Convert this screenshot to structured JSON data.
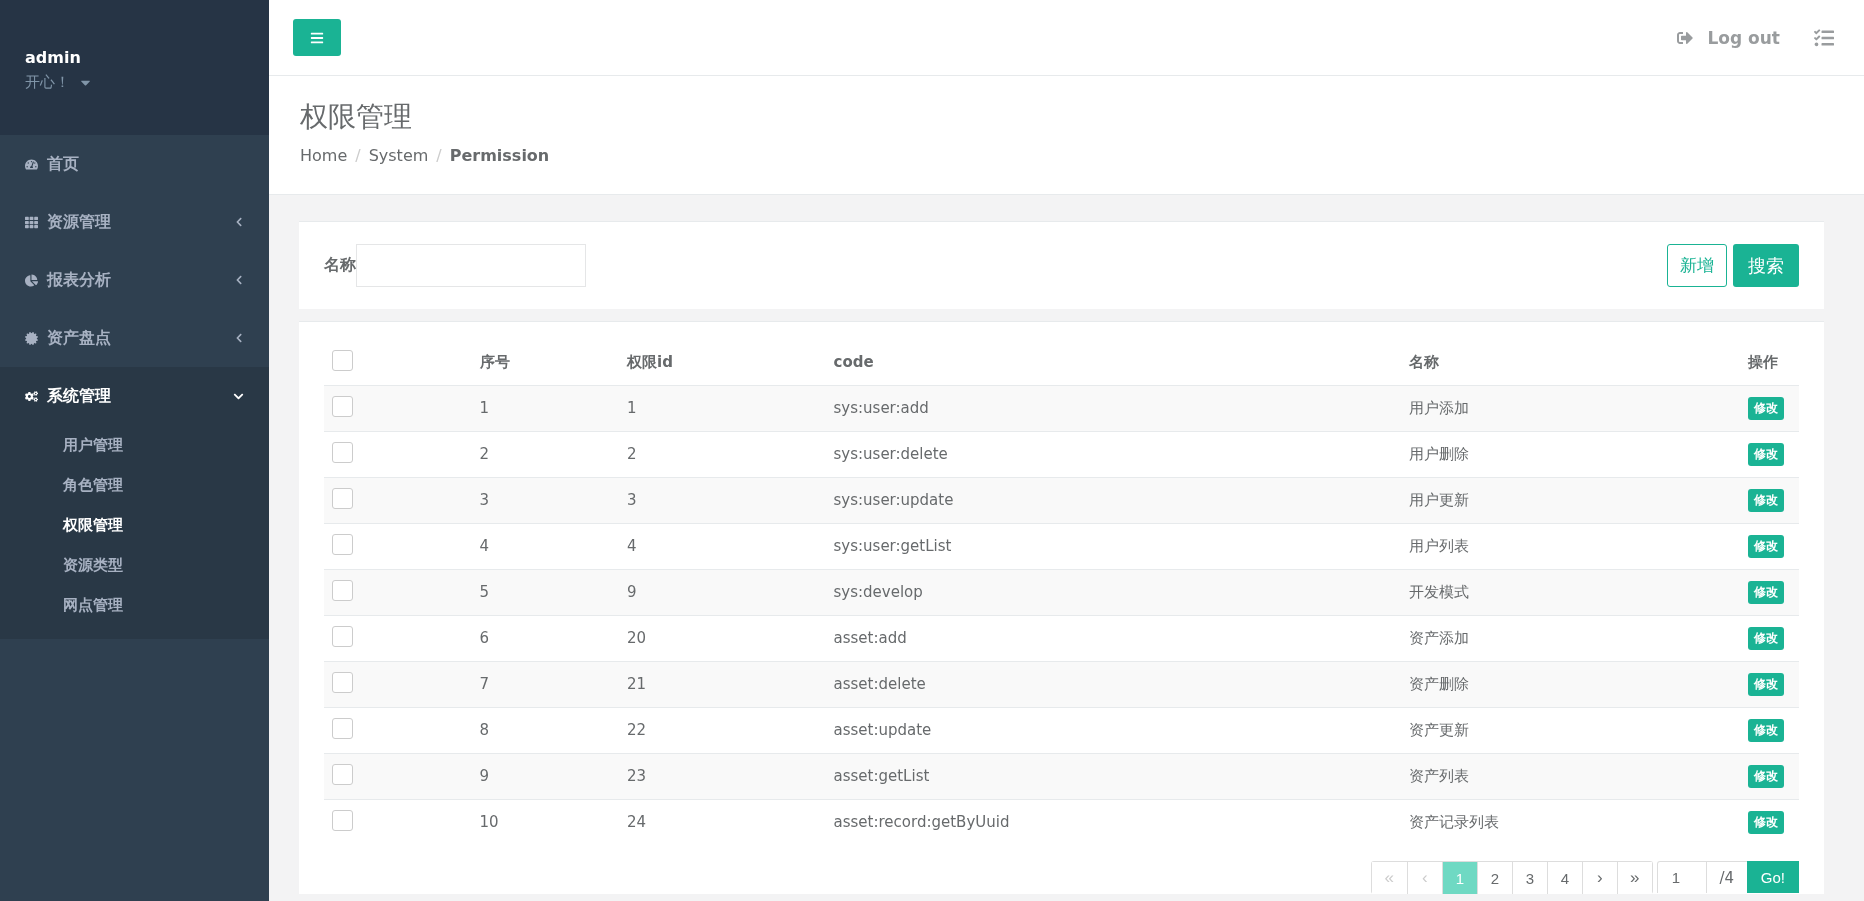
{
  "profile": {
    "name": "admin",
    "status": "开心！"
  },
  "sidebar": {
    "items": [
      {
        "label": "首页"
      },
      {
        "label": "资源管理",
        "expanded": false
      },
      {
        "label": "报表分析",
        "expanded": false
      },
      {
        "label": "资产盘点",
        "expanded": false
      },
      {
        "label": "系统管理",
        "expanded": true,
        "children": [
          {
            "label": "用户管理",
            "selected": false
          },
          {
            "label": "角色管理",
            "selected": false
          },
          {
            "label": "权限管理",
            "selected": true
          },
          {
            "label": "资源类型",
            "selected": false
          },
          {
            "label": "网点管理",
            "selected": false
          }
        ]
      }
    ]
  },
  "topbar": {
    "logout": "Log out"
  },
  "page_header": {
    "title": "权限管理",
    "separator": "/",
    "breadcrumb": [
      {
        "label": "Home",
        "current": false
      },
      {
        "label": "System",
        "current": false
      },
      {
        "label": "Permission",
        "current": true
      }
    ]
  },
  "search": {
    "label": "名称",
    "add_button": "新增",
    "search_button": "搜索"
  },
  "table": {
    "header_checked": false,
    "columns": [
      "序号",
      "权限id",
      "code",
      "名称",
      "操作"
    ],
    "rows": [
      {
        "checked": false,
        "cells": [
          "1",
          "1",
          "sys:user:add",
          "用户添加"
        ],
        "action": "修改"
      },
      {
        "checked": false,
        "cells": [
          "2",
          "2",
          "sys:user:delete",
          "用户删除"
        ],
        "action": "修改"
      },
      {
        "checked": false,
        "cells": [
          "3",
          "3",
          "sys:user:update",
          "用户更新"
        ],
        "action": "修改"
      },
      {
        "checked": false,
        "cells": [
          "4",
          "4",
          "sys:user:getList",
          "用户列表"
        ],
        "action": "修改"
      },
      {
        "checked": false,
        "cells": [
          "5",
          "9",
          "sys:develop",
          "开发模式"
        ],
        "action": "修改"
      },
      {
        "checked": false,
        "cells": [
          "6",
          "20",
          "asset:add",
          "资产添加"
        ],
        "action": "修改"
      },
      {
        "checked": false,
        "cells": [
          "7",
          "21",
          "asset:delete",
          "资产删除"
        ],
        "action": "修改"
      },
      {
        "checked": false,
        "cells": [
          "8",
          "22",
          "asset:update",
          "资产更新"
        ],
        "action": "修改"
      },
      {
        "checked": false,
        "cells": [
          "9",
          "23",
          "asset:getList",
          "资产列表"
        ],
        "action": "修改"
      },
      {
        "checked": false,
        "cells": [
          "10",
          "24",
          "asset:record:getByUuid",
          "资产记录列表"
        ],
        "action": "修改"
      }
    ]
  },
  "pagination": {
    "items": [
      {
        "kind": "first",
        "label": "«",
        "disabled": true,
        "selected": false
      },
      {
        "kind": "prev",
        "label": "‹",
        "disabled": true,
        "selected": false
      },
      {
        "kind": "page",
        "label": "1",
        "disabled": false,
        "selected": true
      },
      {
        "kind": "page",
        "label": "2",
        "disabled": false,
        "selected": false
      },
      {
        "kind": "page",
        "label": "3",
        "disabled": false,
        "selected": false
      },
      {
        "kind": "page",
        "label": "4",
        "disabled": false,
        "selected": false
      },
      {
        "kind": "next",
        "label": "›",
        "disabled": false,
        "selected": false
      },
      {
        "kind": "last",
        "label": "»",
        "disabled": false,
        "selected": false
      }
    ],
    "page_input": "1",
    "total": "/4",
    "go": "Go!"
  }
}
